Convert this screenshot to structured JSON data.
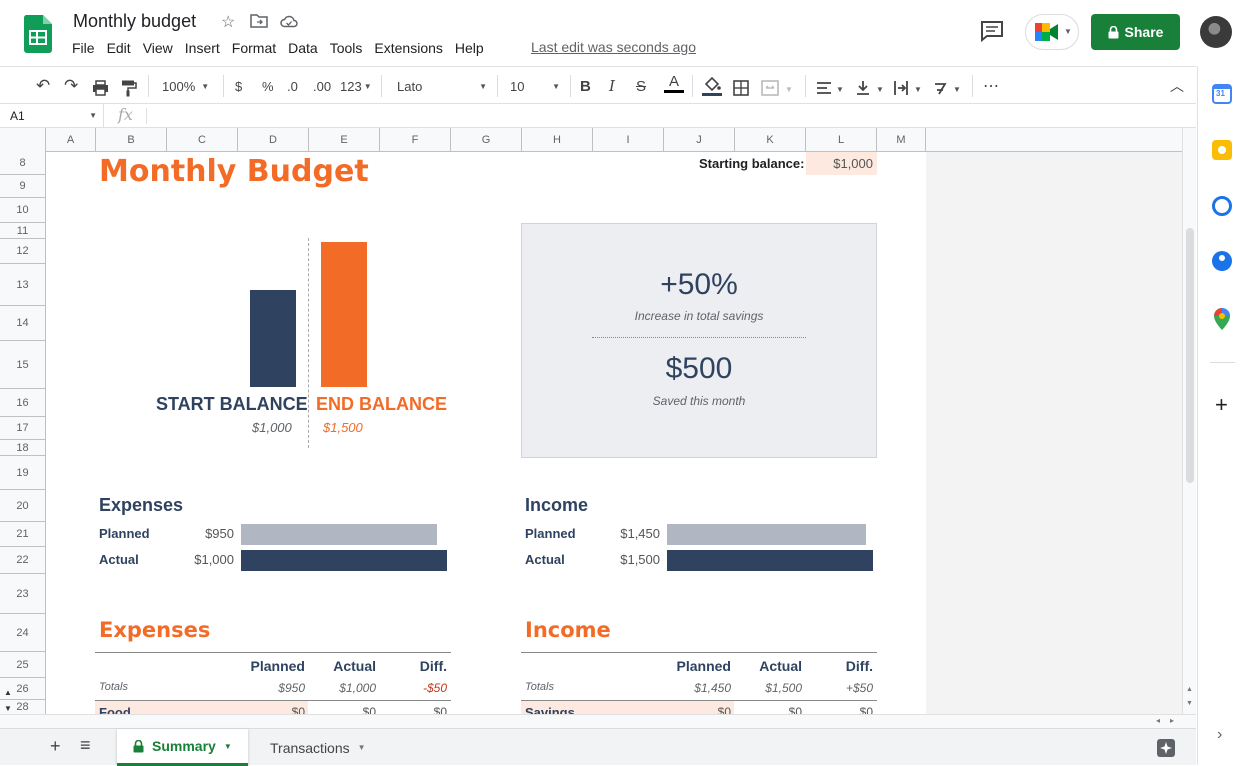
{
  "header": {
    "title": "Monthly budget",
    "menu": [
      "File",
      "Edit",
      "View",
      "Insert",
      "Format",
      "Data",
      "Tools",
      "Extensions",
      "Help"
    ],
    "last_edit": "Last edit was seconds ago",
    "share_label": "Share",
    "icons": {
      "logo": "sheets-logo-icon",
      "star": "star-icon",
      "move": "folder-move-icon",
      "cloud": "cloud-status-icon",
      "comment": "comment-icon",
      "meet": "meet-icon",
      "lock": "lock-icon"
    },
    "brand_color": "#188038"
  },
  "toolbar": {
    "zoom": "100%",
    "currency": "$",
    "percent": "%",
    "dec_decrease": ".0",
    "dec_increase": ".00",
    "number_format": "123",
    "font": "Lato",
    "font_size": "10",
    "bold": "B",
    "italic": "I",
    "strike": "S",
    "text_color": "A",
    "more": "⋯"
  },
  "formula_bar": {
    "cell_ref": "A1",
    "fx": "fx"
  },
  "grid": {
    "columns": [
      "A",
      "B",
      "C",
      "D",
      "E",
      "F",
      "G",
      "H",
      "I",
      "J",
      "K",
      "L",
      "M"
    ],
    "rows": [
      "8",
      "9",
      "10",
      "11",
      "12",
      "13",
      "14",
      "15",
      "16",
      "17",
      "18",
      "19",
      "20",
      "21",
      "22",
      "23",
      "24",
      "25",
      "26",
      "28"
    ]
  },
  "sheet": {
    "title": "Monthly Budget",
    "starting_balance_label": "Starting balance:",
    "starting_balance_value": "$1,000",
    "balance_chart": {
      "start_label": "START BALANCE",
      "start_value": "$1,000",
      "end_label": "END BALANCE",
      "end_value": "$1,500"
    },
    "savings_box": {
      "pct": "+50%",
      "pct_caption": "Increase in total savings",
      "saved": "$500",
      "saved_caption": "Saved this month"
    },
    "expenses_summary": {
      "heading": "Expenses",
      "planned_label": "Planned",
      "planned_value": "$950",
      "actual_label": "Actual",
      "actual_value": "$1,000"
    },
    "income_summary": {
      "heading": "Income",
      "planned_label": "Planned",
      "planned_value": "$1,450",
      "actual_label": "Actual",
      "actual_value": "$1,500"
    },
    "expenses_table": {
      "heading": "Expenses",
      "cols": [
        "Planned",
        "Actual",
        "Diff."
      ],
      "totals_label": "Totals",
      "totals": [
        "$950",
        "$1,000",
        "-$50"
      ],
      "first_row": [
        "Food",
        "$0",
        "$0",
        "$0"
      ]
    },
    "income_table": {
      "heading": "Income",
      "cols": [
        "Planned",
        "Actual",
        "Diff."
      ],
      "totals_label": "Totals",
      "totals": [
        "$1,450",
        "$1,500",
        "+$50"
      ],
      "first_row": [
        "Savings",
        "$0",
        "$0",
        "$0"
      ]
    },
    "colors": {
      "orange": "#f26b27",
      "navy": "#2f4360",
      "gray_bar": "#b0b7c3",
      "box_bg": "#eceef1",
      "peach": "#fde9df"
    }
  },
  "tabs": {
    "add": "+",
    "list": "≡",
    "items": [
      {
        "label": "Summary",
        "active": true
      },
      {
        "label": "Transactions",
        "active": false
      }
    ]
  }
}
